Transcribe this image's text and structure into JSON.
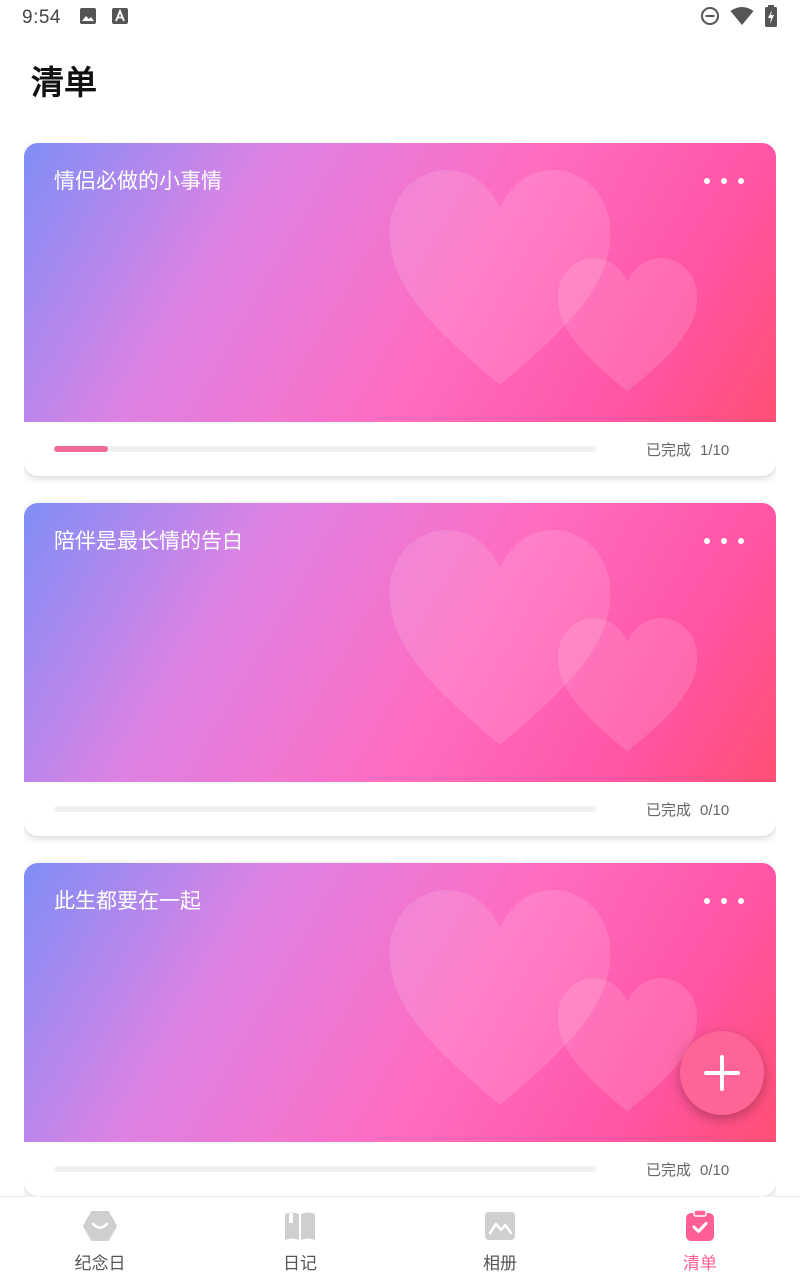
{
  "status_bar": {
    "time": "9:54"
  },
  "page": {
    "title": "清单"
  },
  "lists": [
    {
      "title": "情侣必做的小事情",
      "progress_label": "已完成",
      "progress_count": "1/10",
      "completed": 1,
      "total": 10
    },
    {
      "title": "陪伴是最长情的告白",
      "progress_label": "已完成",
      "progress_count": "0/10",
      "completed": 0,
      "total": 10
    },
    {
      "title": "此生都要在一起",
      "progress_label": "已完成",
      "progress_count": "0/10",
      "completed": 0,
      "total": 10
    }
  ],
  "fab": {
    "icon": "plus-icon"
  },
  "bottom_nav": {
    "items": [
      {
        "label": "纪念日",
        "icon": "anniversary-icon",
        "active": false
      },
      {
        "label": "日记",
        "icon": "diary-book-icon",
        "active": false
      },
      {
        "label": "相册",
        "icon": "album-photo-icon",
        "active": false
      },
      {
        "label": "清单",
        "icon": "checklist-icon",
        "active": true
      }
    ]
  },
  "colors": {
    "accent": "#ff5f94",
    "progress_fill": "#f06a9a",
    "fab": "#ff6497",
    "inactive_icon": "#c9c9c9"
  }
}
